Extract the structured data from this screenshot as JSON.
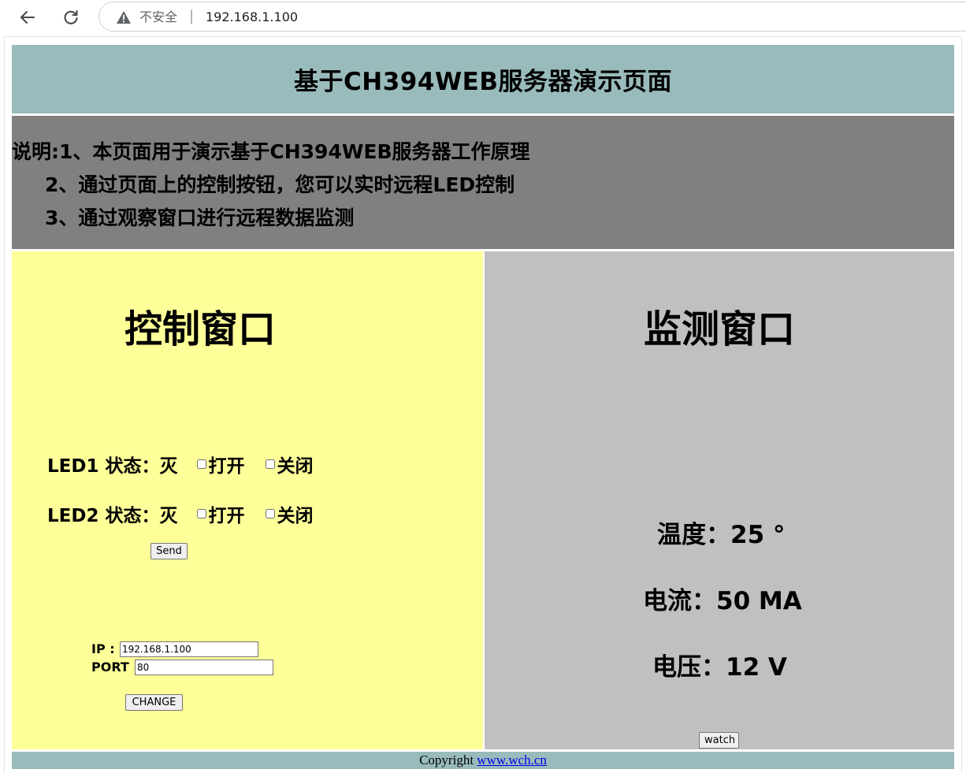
{
  "browser": {
    "security_label": "不安全",
    "separator": "|",
    "url": "192.168.1.100",
    "icons": [
      "back-arrow-icon",
      "reload-icon",
      "warning-icon"
    ]
  },
  "page": {
    "title": "基于CH394WEB服务器演示页面",
    "description": {
      "line1": "说明:1、本页面用于演示基于CH394WEB服务器工作原理",
      "line2": "2、通过页面上的控制按钮，您可以实时远程LED控制",
      "line3": "3、通过观察窗口进行远程数据监测"
    },
    "colors": {
      "header_bg": "#99bbbb",
      "description_bg": "#808080",
      "control_bg": "#ffff99",
      "monitor_bg": "#c0c0c0"
    }
  },
  "control": {
    "title": "控制窗口",
    "led1": {
      "label": "LED1 状态：",
      "state": "灭",
      "open_label": "打开",
      "close_label": "关闭",
      "open_checked": false,
      "close_checked": false
    },
    "led2": {
      "label": "LED2 状态：",
      "state": "灭",
      "open_label": "打开",
      "close_label": "关闭",
      "open_checked": false,
      "close_checked": false
    },
    "send_label": "Send",
    "ip_label": "IP :",
    "ip_value": "192.168.1.100",
    "port_label": "PORT :",
    "port_value": "80",
    "change_label": "CHANGE"
  },
  "monitor": {
    "title": "监测窗口",
    "temperature": "温度：25 °",
    "current": "电流：50 MA",
    "voltage": "电压：12 V",
    "watch_label": "watch"
  },
  "footer": {
    "copyright": "Copyright",
    "link_text": "www.wch.cn"
  }
}
